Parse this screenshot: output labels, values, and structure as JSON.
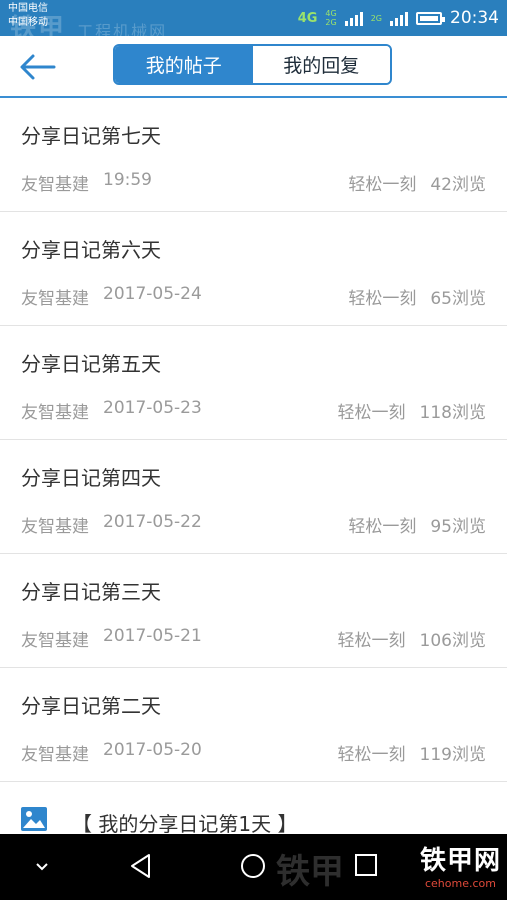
{
  "status_bar": {
    "carrier_1": "中国电信",
    "carrier_2": "中国移动",
    "network_1": "4G",
    "network_2a": "4G",
    "network_2b": "2G",
    "network_3": "2G",
    "time": "20:34"
  },
  "watermark": {
    "top_brand": "铁甲",
    "top_text": "工程机械网",
    "top_domain": "cehome.com",
    "bottom_text": "铁甲",
    "logo_text": "铁甲网",
    "logo_domain": "cehome.com"
  },
  "header": {
    "tab_my_posts": "我的帖子",
    "tab_my_replies": "我的回复",
    "active_tab": "我的帖子"
  },
  "posts": [
    {
      "title": "分享日记第七天",
      "author": "友智基建",
      "date": "19:59",
      "category": "轻松一刻",
      "views": "42浏览"
    },
    {
      "title": "分享日记第六天",
      "author": "友智基建",
      "date": "2017-05-24",
      "category": "轻松一刻",
      "views": "65浏览"
    },
    {
      "title": "分享日记第五天",
      "author": "友智基建",
      "date": "2017-05-23",
      "category": "轻松一刻",
      "views": "118浏览"
    },
    {
      "title": "分享日记第四天",
      "author": "友智基建",
      "date": "2017-05-22",
      "category": "轻松一刻",
      "views": "95浏览"
    },
    {
      "title": "分享日记第三天",
      "author": "友智基建",
      "date": "2017-05-21",
      "category": "轻松一刻",
      "views": "106浏览"
    },
    {
      "title": "分享日记第二天",
      "author": "友智基建",
      "date": "2017-05-20",
      "category": "轻松一刻",
      "views": "119浏览"
    }
  ],
  "partial_post": {
    "title": "【 我的分享日记第1天 】",
    "icon": "image-icon"
  },
  "colors": {
    "status_bar": "#2a7fbd",
    "accent": "#2f86cd",
    "meta_text": "#9a9a9a"
  }
}
